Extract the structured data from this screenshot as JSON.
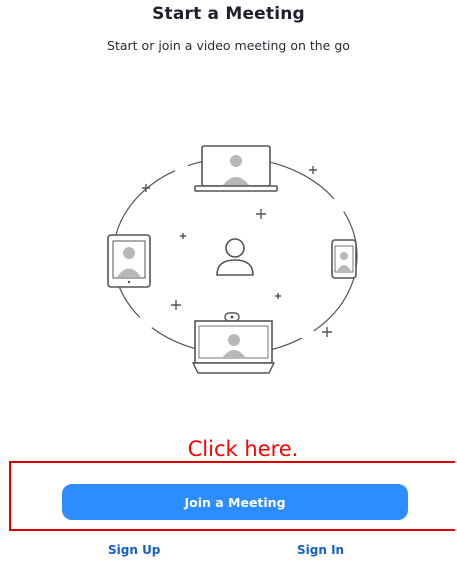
{
  "header": {
    "title": "Start a Meeting",
    "subtitle": "Start or join a video meeting on the go"
  },
  "illustration": {
    "icons": [
      "laptop-icon",
      "tablet-icon",
      "phone-icon",
      "user-icon",
      "conference-room-icon",
      "plus-icon"
    ]
  },
  "annotation": {
    "text": "Click here.",
    "color": "#ff0000"
  },
  "actions": {
    "join_label": "Join a Meeting",
    "signup_label": "Sign Up",
    "signin_label": "Sign In"
  },
  "colors": {
    "accent": "#2d8cff",
    "link": "#1460c8",
    "highlight": "#e00000"
  }
}
